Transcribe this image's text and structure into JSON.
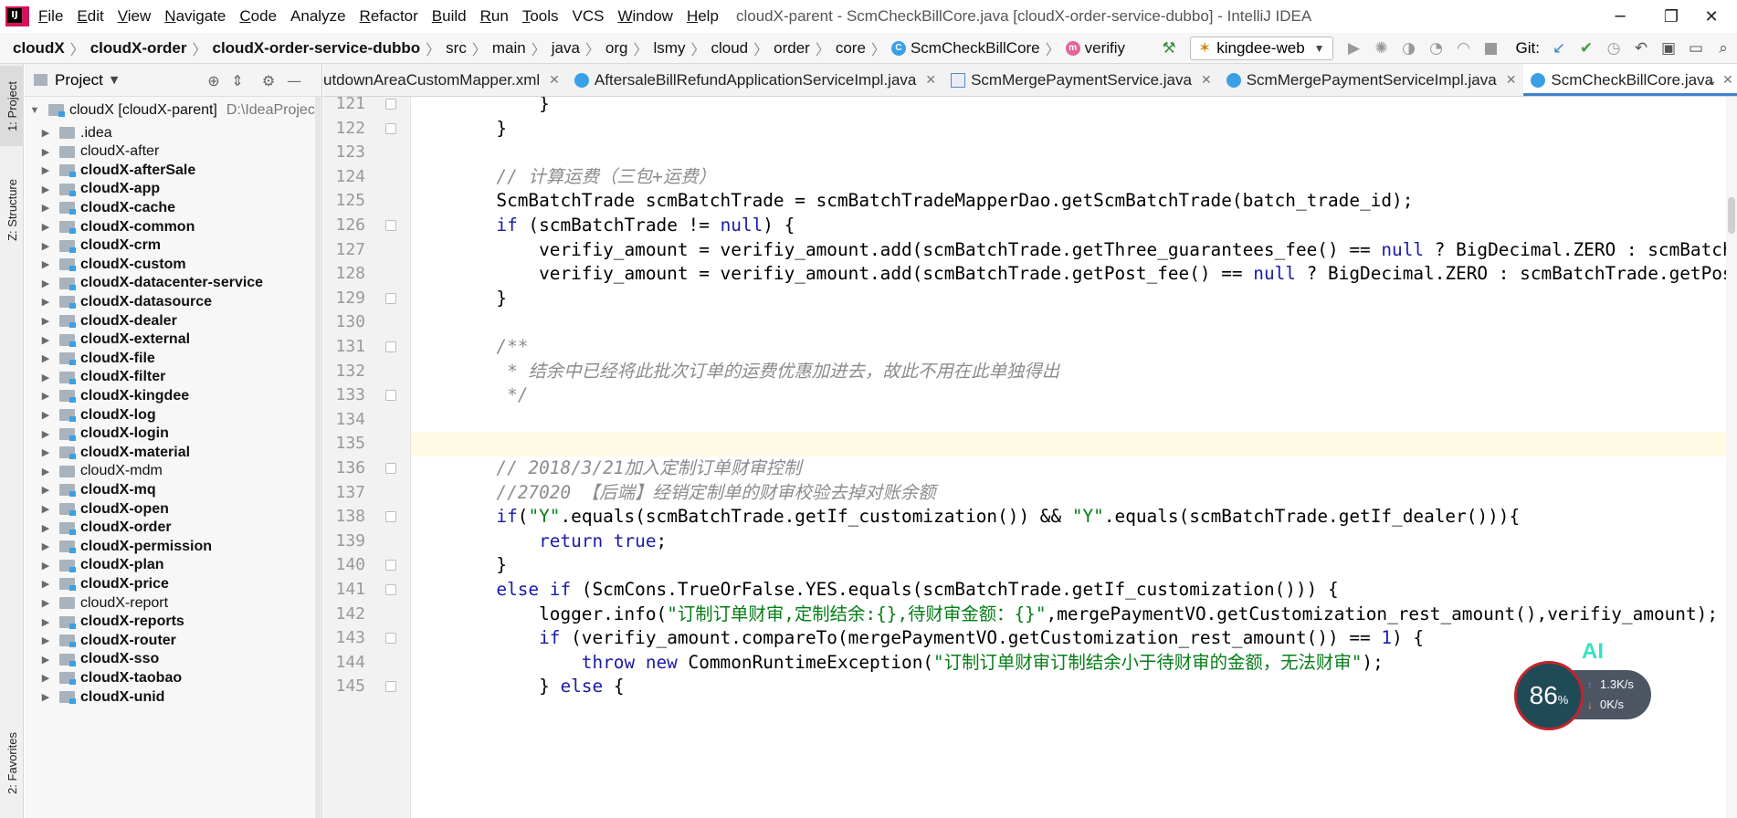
{
  "window": {
    "title": "cloudX-parent - ScmCheckBillCore.java [cloudX-order-service-dubbo] - IntelliJ IDEA",
    "logo_text": "IJ",
    "controls": [
      "─",
      "❐",
      "✕"
    ]
  },
  "menu": [
    {
      "mn": "F",
      "rest": "ile"
    },
    {
      "mn": "E",
      "rest": "dit"
    },
    {
      "mn": "V",
      "rest": "iew"
    },
    {
      "mn": "N",
      "rest": "avigate"
    },
    {
      "mn": "C",
      "rest": "ode"
    },
    {
      "mn": "",
      "rest": "Analyze"
    },
    {
      "mn": "R",
      "rest": "efactor"
    },
    {
      "mn": "B",
      "rest": "uild"
    },
    {
      "mn": "R",
      "rest": "un"
    },
    {
      "mn": "T",
      "rest": "ools"
    },
    {
      "mn": "",
      "rest": "VCS"
    },
    {
      "mn": "W",
      "rest": "indow"
    },
    {
      "mn": "H",
      "rest": "elp"
    }
  ],
  "breadcrumb": [
    {
      "label": "cloudX",
      "bold": true
    },
    {
      "label": "cloudX-order",
      "bold": true
    },
    {
      "label": "cloudX-order-service-dubbo",
      "bold": true
    },
    {
      "label": "src",
      "bold": false
    },
    {
      "label": "main",
      "bold": false
    },
    {
      "label": "java",
      "bold": false
    },
    {
      "label": "org",
      "bold": false
    },
    {
      "label": "lsmy",
      "bold": false
    },
    {
      "label": "cloud",
      "bold": false
    },
    {
      "label": "order",
      "bold": false
    },
    {
      "label": "core",
      "bold": false
    },
    {
      "label": "ScmCheckBillCore",
      "bold": false,
      "icon": "C",
      "icon_color": "#3aa0e6"
    },
    {
      "label": "verifiy",
      "bold": false,
      "icon": "m",
      "icon_color": "#e0669a"
    }
  ],
  "toolbar": {
    "run_config": "kingdee-web",
    "git_label": "Git:"
  },
  "left_strip": [
    "1: Project",
    "Z: Structure",
    "2: Favorites"
  ],
  "project_panel": {
    "title": "Project",
    "root": {
      "name": "cloudX [cloudX-parent]",
      "path": "D:\\IdeaProjec"
    },
    "items": [
      {
        "name": ".idea",
        "bold": false,
        "module": false
      },
      {
        "name": "cloudX-after",
        "bold": false,
        "module": false
      },
      {
        "name": "cloudX-afterSale",
        "bold": true,
        "module": true
      },
      {
        "name": "cloudX-app",
        "bold": true,
        "module": true
      },
      {
        "name": "cloudX-cache",
        "bold": true,
        "module": true
      },
      {
        "name": "cloudX-common",
        "bold": true,
        "module": true
      },
      {
        "name": "cloudX-crm",
        "bold": true,
        "module": true
      },
      {
        "name": "cloudX-custom",
        "bold": true,
        "module": true
      },
      {
        "name": "cloudX-datacenter-service",
        "bold": true,
        "module": true
      },
      {
        "name": "cloudX-datasource",
        "bold": true,
        "module": true
      },
      {
        "name": "cloudX-dealer",
        "bold": true,
        "module": true
      },
      {
        "name": "cloudX-external",
        "bold": true,
        "module": true
      },
      {
        "name": "cloudX-file",
        "bold": true,
        "module": true
      },
      {
        "name": "cloudX-filter",
        "bold": true,
        "module": true
      },
      {
        "name": "cloudX-kingdee",
        "bold": true,
        "module": true
      },
      {
        "name": "cloudX-log",
        "bold": true,
        "module": true
      },
      {
        "name": "cloudX-login",
        "bold": true,
        "module": true
      },
      {
        "name": "cloudX-material",
        "bold": true,
        "module": true
      },
      {
        "name": "cloudX-mdm",
        "bold": false,
        "module": false
      },
      {
        "name": "cloudX-mq",
        "bold": true,
        "module": true
      },
      {
        "name": "cloudX-open",
        "bold": true,
        "module": true
      },
      {
        "name": "cloudX-order",
        "bold": true,
        "module": true
      },
      {
        "name": "cloudX-permission",
        "bold": true,
        "module": true
      },
      {
        "name": "cloudX-plan",
        "bold": true,
        "module": true
      },
      {
        "name": "cloudX-price",
        "bold": true,
        "module": true
      },
      {
        "name": "cloudX-report",
        "bold": false,
        "module": false
      },
      {
        "name": "cloudX-reports",
        "bold": true,
        "module": true
      },
      {
        "name": "cloudX-router",
        "bold": true,
        "module": true
      },
      {
        "name": "cloudX-sso",
        "bold": true,
        "module": true
      },
      {
        "name": "cloudX-taobao",
        "bold": true,
        "module": true
      },
      {
        "name": "cloudX-unid",
        "bold": true,
        "module": true
      }
    ]
  },
  "editor_tabs": [
    {
      "label": "utdownAreaCustomMapper.xml",
      "type": "xml",
      "active": false
    },
    {
      "label": "AftersaleBillRefundApplicationServiceImpl.java",
      "type": "cls",
      "active": false
    },
    {
      "label": "ScmMergePaymentService.java",
      "type": "java",
      "active": false
    },
    {
      "label": "ScmMergePaymentServiceImpl.java",
      "type": "cls",
      "active": false
    },
    {
      "label": "ScmCheckBillCore.java",
      "type": "cls",
      "active": true
    }
  ],
  "code_lines": [
    {
      "n": "121",
      "fold": true,
      "tokens": [
        [
          "",
          "            }"
        ]
      ]
    },
    {
      "n": "122",
      "fold": true,
      "tokens": [
        [
          "",
          "        }"
        ]
      ]
    },
    {
      "n": "123",
      "fold": false,
      "tokens": [
        [
          "",
          ""
        ]
      ]
    },
    {
      "n": "124",
      "fold": false,
      "tokens": [
        [
          "cmt",
          "        // 计算运费（三包+运费）"
        ]
      ]
    },
    {
      "n": "125",
      "fold": false,
      "tokens": [
        [
          "",
          "        ScmBatchTrade scmBatchTrade = scmBatchTradeMapperDao.getScmBatchTrade(batch_trade_id);"
        ]
      ]
    },
    {
      "n": "126",
      "fold": true,
      "tokens": [
        [
          "kw",
          "        if"
        ],
        [
          "",
          " (scmBatchTrade != "
        ],
        [
          "kw",
          "null"
        ],
        [
          "",
          ") {"
        ]
      ]
    },
    {
      "n": "127",
      "fold": false,
      "tokens": [
        [
          "",
          "            verifiy_amount = verifiy_amount.add(scmBatchTrade.getThree_guarantees_fee() == "
        ],
        [
          "kw",
          "null"
        ],
        [
          "",
          " ? BigDecimal.ZERO : scmBatchTrade.getThree_guarantees_fee());"
        ]
      ]
    },
    {
      "n": "128",
      "fold": false,
      "tokens": [
        [
          "",
          "            verifiy_amount = verifiy_amount.add(scmBatchTrade.getPost_fee() == "
        ],
        [
          "kw",
          "null"
        ],
        [
          "",
          " ? BigDecimal.ZERO : scmBatchTrade.getPost_fee());"
        ]
      ]
    },
    {
      "n": "129",
      "fold": true,
      "tokens": [
        [
          "",
          "        }"
        ]
      ]
    },
    {
      "n": "130",
      "fold": false,
      "tokens": [
        [
          "",
          ""
        ]
      ]
    },
    {
      "n": "131",
      "fold": true,
      "tokens": [
        [
          "doc",
          "        /**"
        ]
      ]
    },
    {
      "n": "132",
      "fold": false,
      "tokens": [
        [
          "doc",
          "         * 结余中已经将此批次订单的运费优惠加进去，故此不用在此单独得出"
        ]
      ]
    },
    {
      "n": "133",
      "fold": true,
      "tokens": [
        [
          "doc",
          "         */"
        ]
      ]
    },
    {
      "n": "134",
      "fold": false,
      "tokens": [
        [
          "",
          ""
        ]
      ]
    },
    {
      "n": "135",
      "fold": false,
      "current": true,
      "tokens": [
        [
          "",
          ""
        ]
      ]
    },
    {
      "n": "136",
      "fold": true,
      "tokens": [
        [
          "cmt",
          "        // 2018/3/21加入定制订单财审控制"
        ]
      ]
    },
    {
      "n": "137",
      "fold": false,
      "tokens": [
        [
          "cmt",
          "        //27020 【后端】经销定制单的财审校验去掉对账余额"
        ]
      ]
    },
    {
      "n": "138",
      "fold": true,
      "tokens": [
        [
          "kw",
          "        if"
        ],
        [
          "",
          "("
        ],
        [
          "str",
          "\"Y\""
        ],
        [
          "",
          ".equals(scmBatchTrade.getIf_customization()) && "
        ],
        [
          "str",
          "\"Y\""
        ],
        [
          "",
          ".equals(scmBatchTrade.getIf_dealer())){"
        ]
      ]
    },
    {
      "n": "139",
      "fold": false,
      "tokens": [
        [
          "kw",
          "            return true"
        ],
        [
          "",
          ";"
        ]
      ]
    },
    {
      "n": "140",
      "fold": true,
      "tokens": [
        [
          "",
          "        }"
        ]
      ]
    },
    {
      "n": "141",
      "fold": true,
      "tokens": [
        [
          "kw",
          "        else if"
        ],
        [
          "",
          " (ScmCons.TrueOrFalse.YES.equals(scmBatchTrade.getIf_customization())) {"
        ]
      ]
    },
    {
      "n": "142",
      "fold": false,
      "tokens": [
        [
          "",
          "            logger.info("
        ],
        [
          "str",
          "\"订制订单财审,定制结余:{},待财审金额：{}\""
        ],
        [
          "",
          ",mergePaymentVO.getCustomization_rest_amount(),verifiy_amount);"
        ]
      ]
    },
    {
      "n": "143",
      "fold": true,
      "tokens": [
        [
          "kw",
          "            if"
        ],
        [
          "",
          " (verifiy_amount.compareTo(mergePaymentVO.getCustomization_rest_amount()) == "
        ],
        [
          "kw",
          "1"
        ],
        [
          "",
          ") {"
        ]
      ]
    },
    {
      "n": "144",
      "fold": false,
      "tokens": [
        [
          "kw",
          "                throw new"
        ],
        [
          "",
          " CommonRuntimeException("
        ],
        [
          "str",
          "\"订制订单财审订制结余小于待财审的金额，无法财审\""
        ],
        [
          "",
          ");"
        ]
      ]
    },
    {
      "n": "145",
      "fold": true,
      "tokens": [
        [
          "",
          "            } "
        ],
        [
          "kw",
          "else"
        ],
        [
          "",
          " {"
        ]
      ]
    }
  ],
  "net_widget": {
    "ai_label": "AI",
    "percent": "86",
    "percent_unit": "%",
    "up_speed": "1.3K/s",
    "down_speed": "0K/s",
    "ring_color": "#c0262d"
  }
}
